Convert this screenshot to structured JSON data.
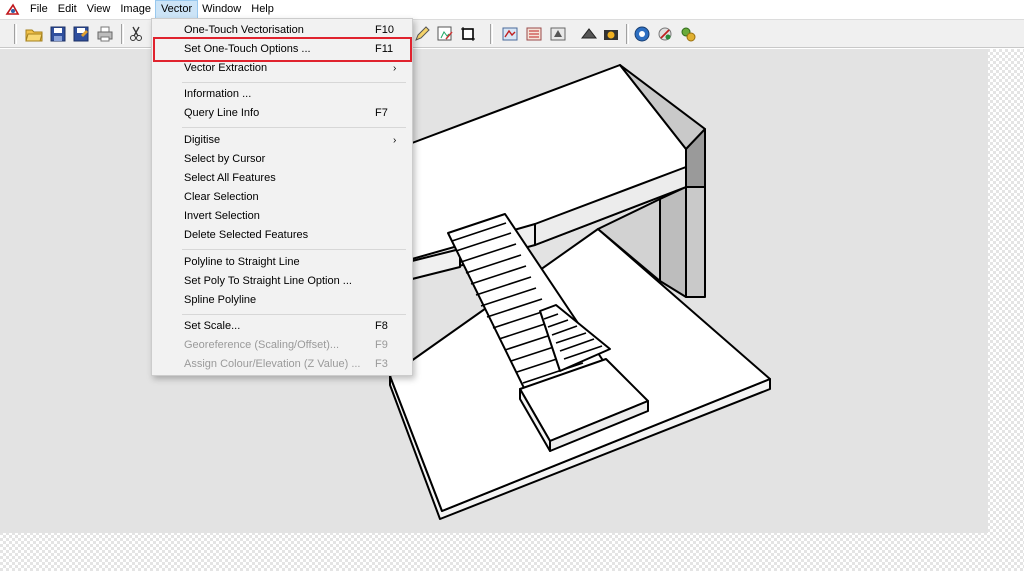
{
  "menubar": {
    "items": [
      "File",
      "Edit",
      "View",
      "Image",
      "Vector",
      "Window",
      "Help"
    ]
  },
  "vector_menu": {
    "one_touch_vectorisation": {
      "label": "One-Touch Vectorisation",
      "shortcut": "F10"
    },
    "set_one_touch_options": {
      "label": "Set One-Touch Options ...",
      "shortcut": "F11"
    },
    "vector_extraction": {
      "label": "Vector Extraction",
      "submenu": "›"
    },
    "information": {
      "label": "Information ..."
    },
    "query_line_info": {
      "label": "Query Line Info",
      "shortcut": "F7"
    },
    "digitise": {
      "label": "Digitise",
      "submenu": "›"
    },
    "select_by_cursor": {
      "label": "Select by Cursor"
    },
    "select_all_features": {
      "label": "Select All Features"
    },
    "clear_selection": {
      "label": "Clear Selection"
    },
    "invert_selection": {
      "label": "Invert Selection"
    },
    "delete_selected_features": {
      "label": "Delete Selected Features"
    },
    "polyline_to_straight_line": {
      "label": "Polyline to Straight Line"
    },
    "set_poly_to_straight_line_option": {
      "label": "Set Poly To Straight Line Option ..."
    },
    "spline_polyline": {
      "label": "Spline Polyline"
    },
    "set_scale": {
      "label": "Set Scale...",
      "shortcut": "F8"
    },
    "georeference": {
      "label": "Georeference (Scaling/Offset)...",
      "shortcut": "F9"
    },
    "assign_colour_elevation": {
      "label": "Assign Colour/Elevation (Z Value) ...",
      "shortcut": "F3"
    }
  },
  "colors": {
    "highlight": "#e0232e",
    "menu_active": "#cce4f7",
    "canvas": "#e3e3e3"
  },
  "icons": [
    "app-icon",
    "open-folder-icon",
    "save-icon",
    "save-as-icon",
    "print-icon",
    "cut-icon",
    "pencil-icon",
    "edit-raster-icon",
    "crop-icon",
    "vector-tool-icons",
    "layer-icons",
    "settings-icons"
  ]
}
